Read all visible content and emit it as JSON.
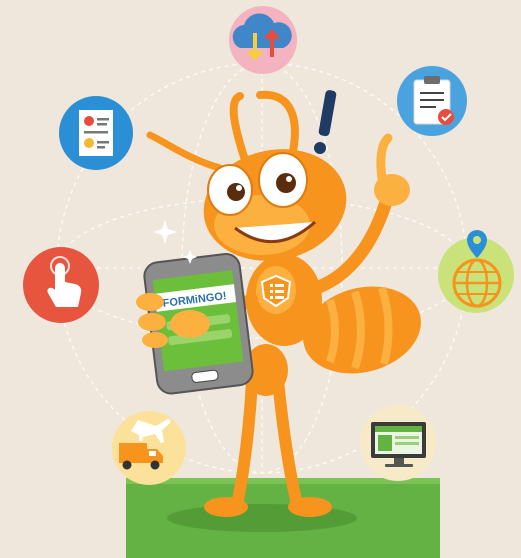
{
  "colors": {
    "background": "#efe7dc",
    "grass": "#64b243",
    "ant_orange": "#f7941d",
    "ant_light": "#fbb040",
    "phone_green": "#6cbf3a",
    "exclamation": "#1f3b63"
  },
  "phone": {
    "logo_text": "FORMiNGO!"
  },
  "icons": [
    {
      "name": "cloud-sync-icon",
      "bg": "#f3b3c1"
    },
    {
      "name": "clipboard-check-icon",
      "bg": "#4aa3df"
    },
    {
      "name": "document-report-icon",
      "bg": "#2b8fd6"
    },
    {
      "name": "location-globe-icon",
      "bg": "#c9e27a"
    },
    {
      "name": "touch-hand-icon",
      "bg": "#e7553f"
    },
    {
      "name": "delivery-truck-plane-icon",
      "bg": "#fbe199"
    },
    {
      "name": "desktop-monitor-icon",
      "bg": "#f6eac8"
    }
  ]
}
